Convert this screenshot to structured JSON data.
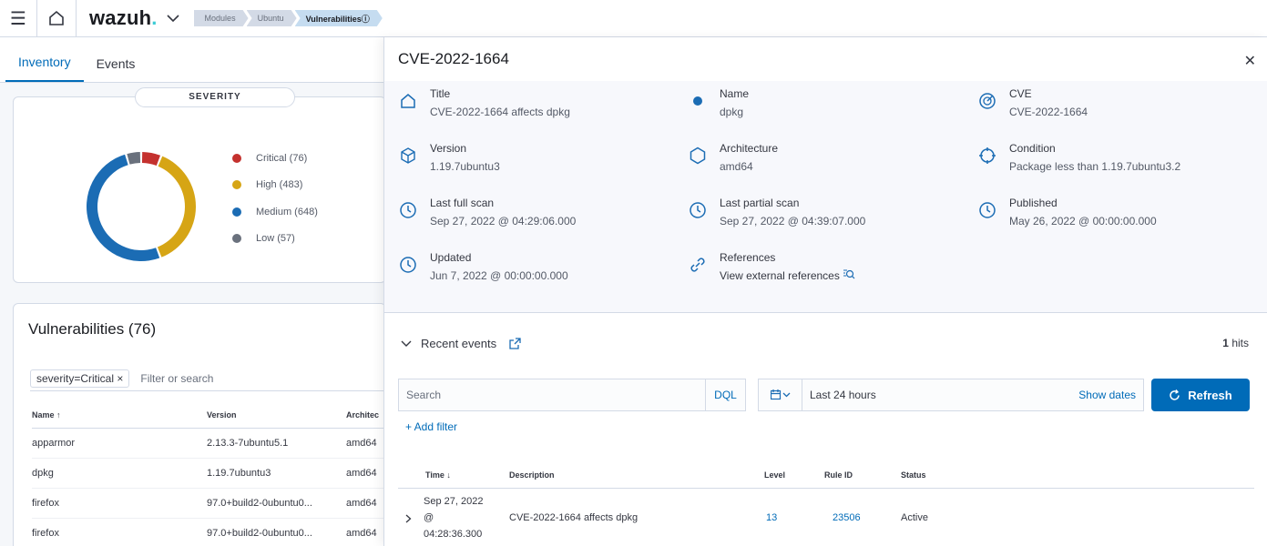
{
  "header": {
    "logo_text": "wazuh",
    "logo_dot": ".",
    "breadcrumbs": [
      "Modules",
      "Ubuntu",
      "Vulnerabilitiesⓘ"
    ]
  },
  "tabs": [
    "Inventory",
    "Events"
  ],
  "severity": {
    "title": "SEVERITY",
    "legend": [
      {
        "label": "Critical (76)",
        "color": "#c4312e",
        "value": 76
      },
      {
        "label": "High (483)",
        "color": "#d6a515",
        "value": 483
      },
      {
        "label": "Medium (648)",
        "color": "#1b6cb4",
        "value": 648
      },
      {
        "label": "Low (57)",
        "color": "#6a717d",
        "value": 57
      }
    ]
  },
  "vulnerabilities": {
    "title": "Vulnerabilities (76)",
    "filter_chip": "severity=Critical",
    "filter_placeholder": "Filter or search",
    "columns": [
      "Name ↑",
      "Version",
      "Architec"
    ],
    "rows": [
      [
        "apparmor",
        "2.13.3-7ubuntu5.1",
        "amd64"
      ],
      [
        "dpkg",
        "1.19.7ubuntu3",
        "amd64"
      ],
      [
        "firefox",
        "97.0+build2-0ubuntu0...",
        "amd64"
      ],
      [
        "firefox",
        "97.0+build2-0ubuntu0...",
        "amd64"
      ]
    ]
  },
  "flyout": {
    "title": "CVE-2022-1664",
    "fields": [
      {
        "label": "Title",
        "value": "CVE-2022-1664 affects dpkg"
      },
      {
        "label": "Name",
        "value": "dpkg"
      },
      {
        "label": "CVE",
        "value": "CVE-2022-1664"
      },
      {
        "label": "Version",
        "value": "1.19.7ubuntu3"
      },
      {
        "label": "Architecture",
        "value": "amd64"
      },
      {
        "label": "Condition",
        "value": "Package less than 1.19.7ubuntu3.2"
      },
      {
        "label": "Last full scan",
        "value": "Sep 27, 2022 @ 04:29:06.000"
      },
      {
        "label": "Last partial scan",
        "value": "Sep 27, 2022 @ 04:39:07.000"
      },
      {
        "label": "Published",
        "value": "May 26, 2022 @ 00:00:00.000"
      },
      {
        "label": "Updated",
        "value": "Jun 7, 2022 @ 00:00:00.000"
      },
      {
        "label": "References",
        "value": "View external references"
      }
    ],
    "recent_events_label": "Recent events",
    "hits_count": "1",
    "hits_label": "hits",
    "search_placeholder": "Search",
    "dql_label": "DQL",
    "date_range": "Last 24 hours",
    "show_dates_label": "Show dates",
    "refresh_label": "Refresh",
    "add_filter_label": "+ Add filter",
    "events_columns": [
      "Time ↓",
      "Description",
      "Level",
      "Rule ID",
      "Status"
    ],
    "event_row": {
      "time_line1": "Sep 27, 2022",
      "time_line2": "@",
      "time_line3": "04:28:36.300",
      "description": "CVE-2022-1664 affects dpkg",
      "level": "13",
      "rule_id": "23506",
      "status": "Active"
    }
  }
}
